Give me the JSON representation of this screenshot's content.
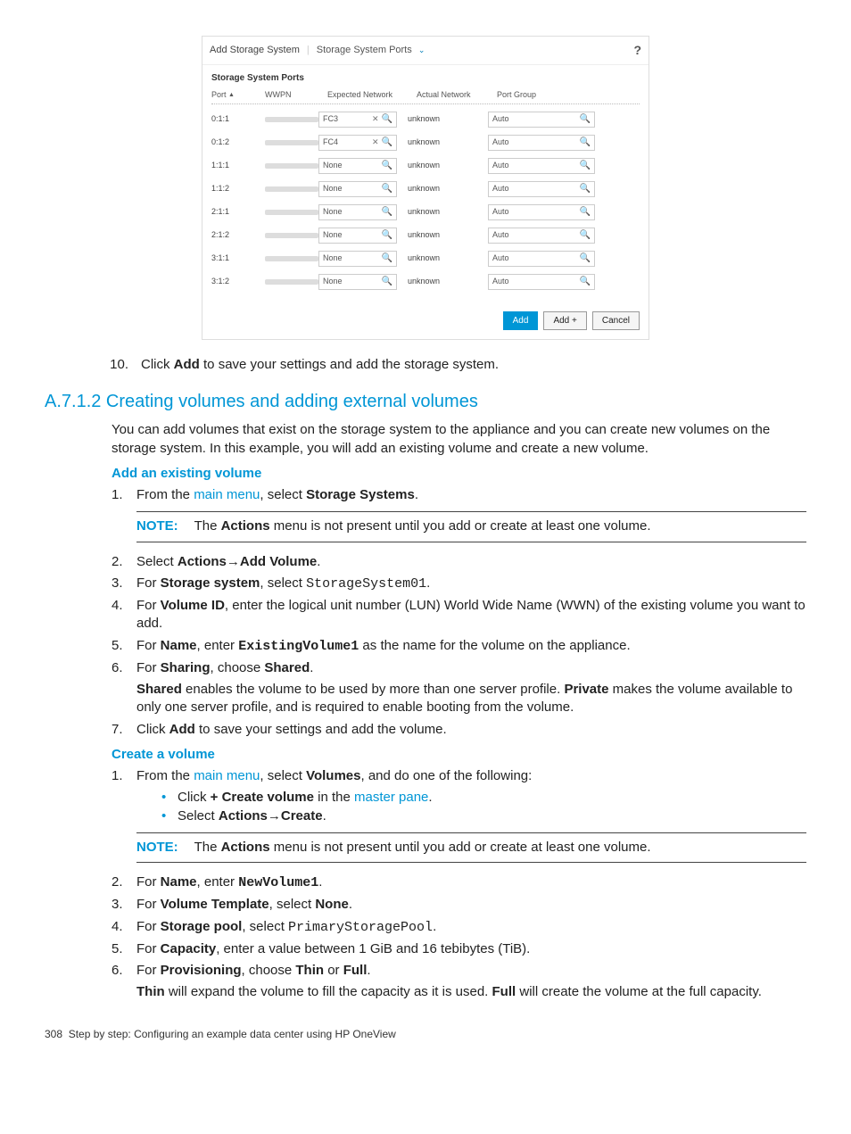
{
  "screenshot": {
    "dialogTitle": "Add Storage System",
    "dropdownLabel": "Storage System Ports",
    "helpIcon": "?",
    "sectionHeader": "Storage System Ports",
    "columns": {
      "port": "Port",
      "wwpn": "WWPN",
      "expected": "Expected Network",
      "actual": "Actual Network",
      "portGroup": "Port Group"
    },
    "rows": [
      {
        "port": "0:1:1",
        "expected": "FC3",
        "showX": true,
        "actual": "unknown",
        "portGroup": "Auto"
      },
      {
        "port": "0:1:2",
        "expected": "FC4",
        "showX": true,
        "actual": "unknown",
        "portGroup": "Auto"
      },
      {
        "port": "1:1:1",
        "expected": "None",
        "showX": false,
        "actual": "unknown",
        "portGroup": "Auto"
      },
      {
        "port": "1:1:2",
        "expected": "None",
        "showX": false,
        "actual": "unknown",
        "portGroup": "Auto"
      },
      {
        "port": "2:1:1",
        "expected": "None",
        "showX": false,
        "actual": "unknown",
        "portGroup": "Auto"
      },
      {
        "port": "2:1:2",
        "expected": "None",
        "showX": false,
        "actual": "unknown",
        "portGroup": "Auto"
      },
      {
        "port": "3:1:1",
        "expected": "None",
        "showX": false,
        "actual": "unknown",
        "portGroup": "Auto"
      },
      {
        "port": "3:1:2",
        "expected": "None",
        "showX": false,
        "actual": "unknown",
        "portGroup": "Auto"
      }
    ],
    "buttons": {
      "add": "Add",
      "addPlus": "Add +",
      "cancel": "Cancel"
    }
  },
  "step10": {
    "num": "10.",
    "pre": "Click ",
    "bold": "Add",
    "post": " to save your settings and add the storage system."
  },
  "sectionHeading": "A.7.1.2 Creating volumes and adding external volumes",
  "intro": "You can add volumes that exist on the storage system to the appliance and you can create new volumes on the storage system. In this example, you will add an existing volume and create a new volume.",
  "addExisting": {
    "heading": "Add an existing volume",
    "s1": {
      "pre": "From the ",
      "link": "main menu",
      "mid": ", select ",
      "bold": "Storage Systems",
      "post": "."
    },
    "note": {
      "label": "NOTE:",
      "pre": "The ",
      "bold": "Actions",
      "post": " menu is not present until you add or create at least one volume."
    },
    "s2": {
      "pre": "Select ",
      "b1": "Actions",
      "arrow": "→",
      "b2": "Add Volume",
      "post": "."
    },
    "s3": {
      "pre": "For ",
      "bold": "Storage system",
      "mid": ", select ",
      "mono": "StorageSystem01",
      "post": "."
    },
    "s4": {
      "pre": "For ",
      "bold": "Volume ID",
      "post": ", enter the logical unit number (LUN) World Wide Name (WWN) of the existing volume you want to add."
    },
    "s5": {
      "pre": "For ",
      "bold": "Name",
      "mid": ", enter ",
      "mono": "ExistingVolume1",
      "post": " as the name for the volume on the appliance."
    },
    "s6": {
      "pre": "For ",
      "bold": "Sharing",
      "mid": ", choose ",
      "b2": "Shared",
      "post": ".",
      "p2_b1": "Shared",
      "p2_t1": " enables the volume to be used by more than one server profile. ",
      "p2_b2": "Private",
      "p2_t2": " makes the volume available to only one server profile, and is required to enable booting from the volume."
    },
    "s7": {
      "pre": "Click ",
      "bold": "Add",
      "post": " to save your settings and add the volume."
    }
  },
  "createVol": {
    "heading": "Create a volume",
    "s1": {
      "pre": "From the ",
      "link": "main menu",
      "mid": ", select ",
      "bold": "Volumes",
      "post": ", and do one of the following:",
      "b1_pre": "Click ",
      "b1_bold": "+ Create volume",
      "b1_mid": " in the ",
      "b1_link": "master pane",
      "b1_post": ".",
      "b2_pre": "Select ",
      "b2_b1": "Actions",
      "b2_arrow": "→",
      "b2_b2": "Create",
      "b2_post": "."
    },
    "note": {
      "label": "NOTE:",
      "pre": "The ",
      "bold": "Actions",
      "post": " menu is not present until you add or create at least one volume."
    },
    "s2": {
      "pre": "For ",
      "bold": "Name",
      "mid": ", enter ",
      "mono": "NewVolume1",
      "post": "."
    },
    "s3": {
      "pre": "For ",
      "bold": "Volume Template",
      "mid": ", select ",
      "b2": "None",
      "post": "."
    },
    "s4": {
      "pre": "For ",
      "bold": "Storage pool",
      "mid": ", select ",
      "mono": "PrimaryStoragePool",
      "post": "."
    },
    "s5": {
      "pre": "For ",
      "bold": "Capacity",
      "post": ", enter a value between 1 GiB and 16 tebibytes (TiB)."
    },
    "s6": {
      "pre": "For ",
      "bold": "Provisioning",
      "mid": ", choose ",
      "b2": "Thin",
      "mid2": " or ",
      "b3": "Full",
      "post": ".",
      "p2_b1": "Thin",
      "p2_t1": " will expand the volume to fill the capacity as it is used. ",
      "p2_b2": "Full",
      "p2_t2": " will create the volume at the full capacity."
    }
  },
  "footer": {
    "page": "308",
    "text": "Step by step: Configuring an example data center using HP OneView"
  }
}
